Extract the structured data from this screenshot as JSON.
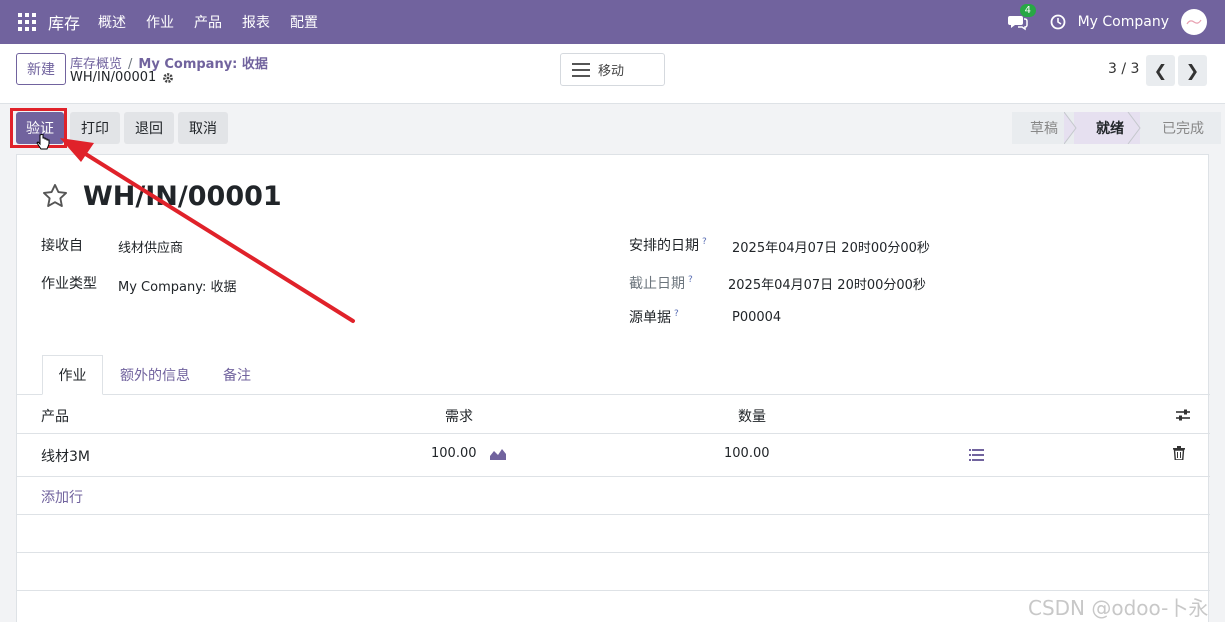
{
  "navbar": {
    "app_name": "库存",
    "menu": [
      "概述",
      "作业",
      "产品",
      "报表",
      "配置"
    ],
    "chat_badge": "4",
    "company": "My Company"
  },
  "control": {
    "new_button": "新建",
    "breadcrumb_parent": "库存概览",
    "breadcrumb_sep": "/",
    "breadcrumb_current": "My Company: 收据",
    "record_name": "WH/IN/00001",
    "move_button": "移动",
    "pager": "3 / 3"
  },
  "actions": {
    "validate": "验证",
    "print": "打印",
    "return": "退回",
    "cancel": "取消"
  },
  "status": {
    "stages": [
      "草稿",
      "就绪",
      "已完成"
    ],
    "active": "就绪"
  },
  "form": {
    "title": "WH/IN/00001",
    "receive_from_label": "接收自",
    "receive_from_value": "线材供应商",
    "op_type_label": "作业类型",
    "op_type_value": "My Company: 收据",
    "scheduled_label": "安排的日期",
    "scheduled_value": "2025年04月07日 20时00分00秒",
    "deadline_label": "截止日期",
    "deadline_value": "2025年04月07日 20时00分00秒",
    "source_label": "源单据",
    "source_value": "P00004",
    "help_mark": "?"
  },
  "tabs": [
    "作业",
    "额外的信息",
    "备注"
  ],
  "table": {
    "headers": {
      "product": "产品",
      "demand": "需求",
      "quantity": "数量"
    },
    "rows": [
      {
        "product": "线材3M",
        "demand": "100.00",
        "quantity": "100.00"
      }
    ],
    "add_line": "添加行"
  },
  "watermark": "CSDN @odoo-卜永",
  "colors": {
    "brand": "#71639e",
    "annotation": "#e0222a"
  }
}
